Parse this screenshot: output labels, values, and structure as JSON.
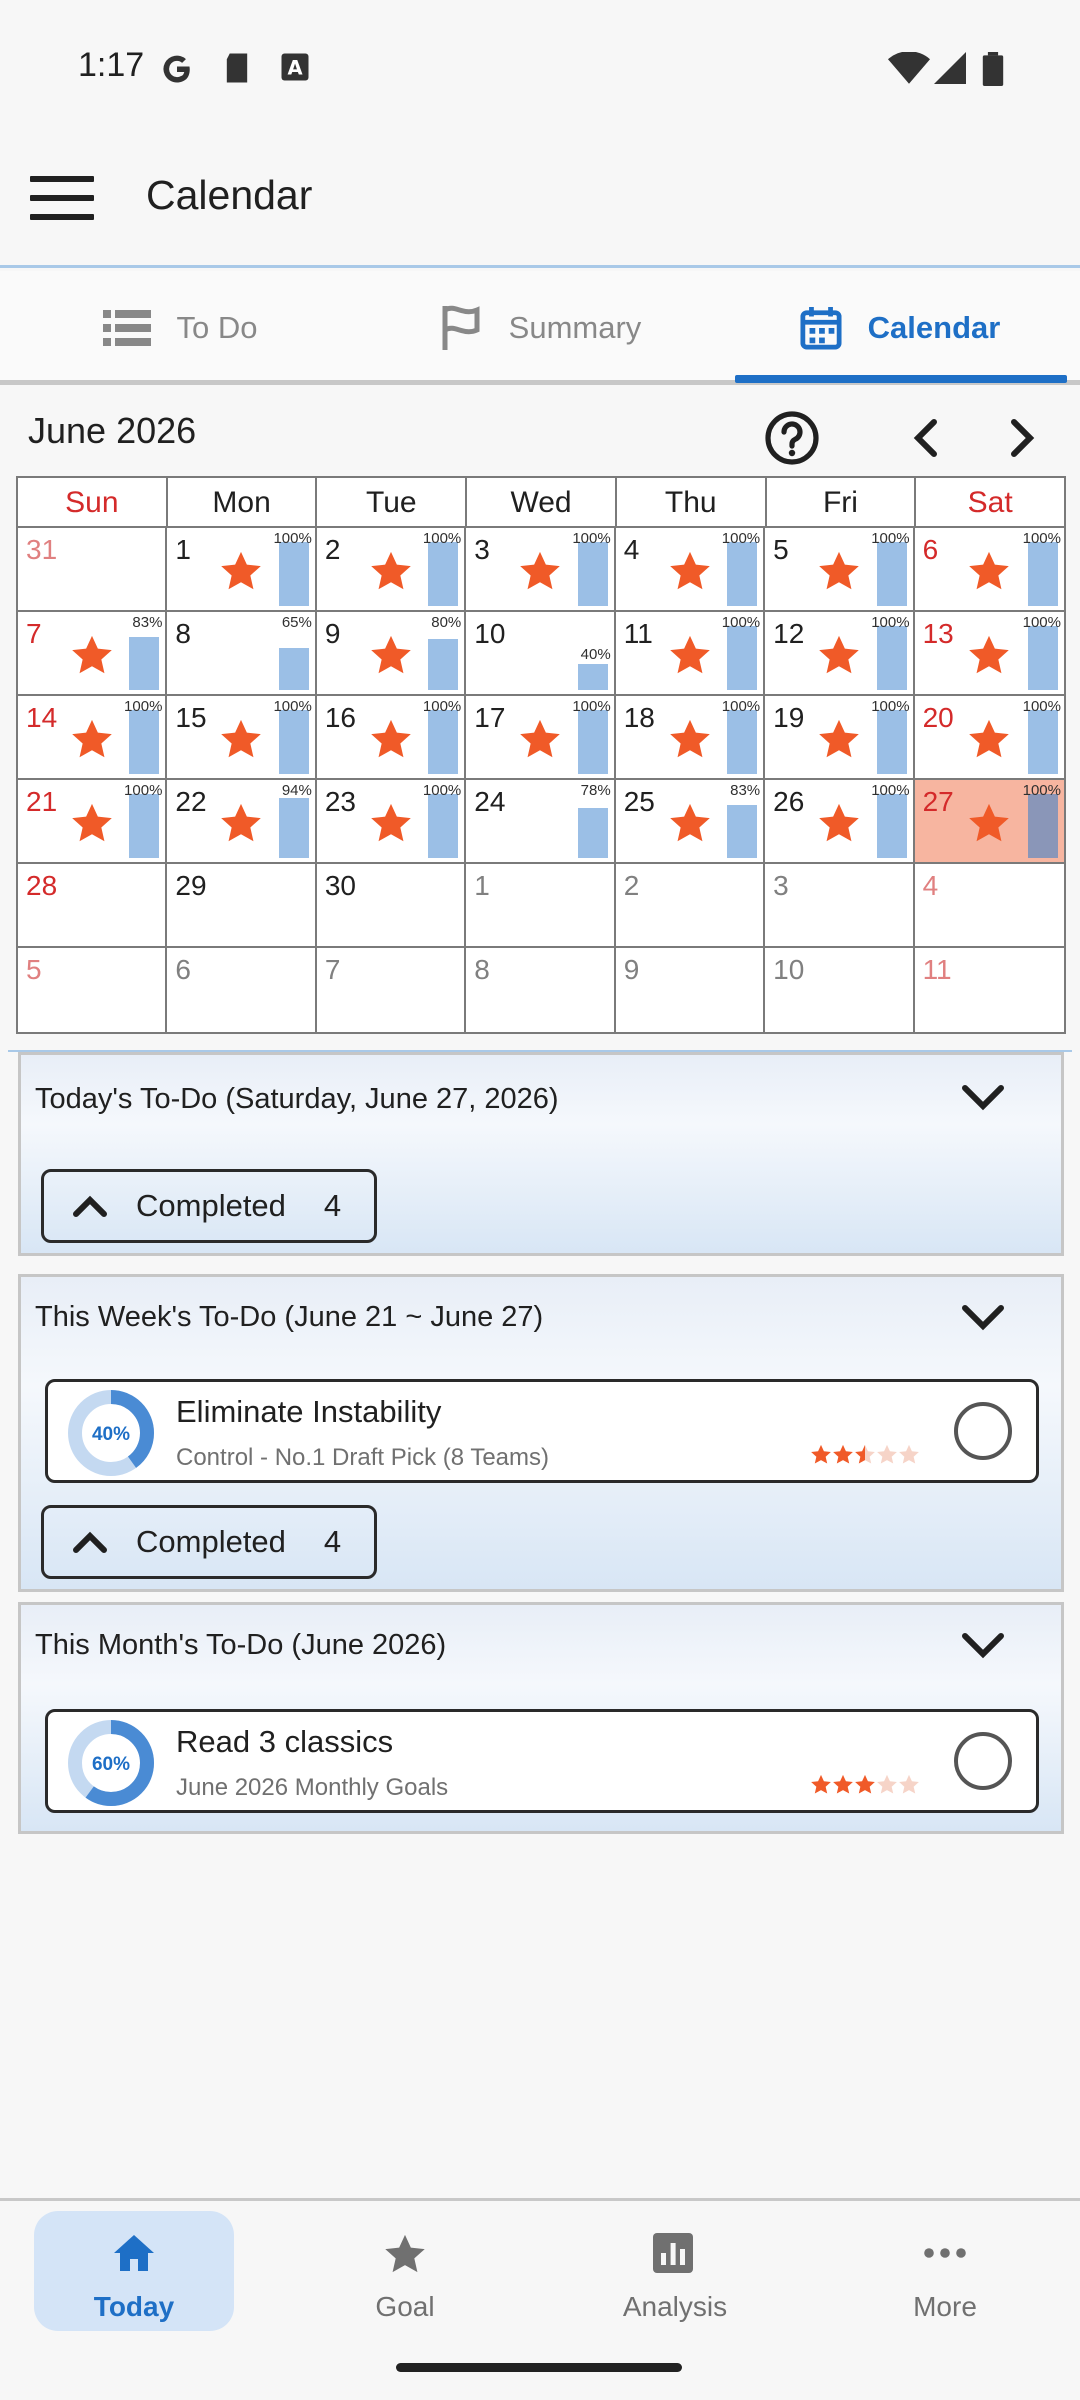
{
  "status_bar": {
    "time": "1:17"
  },
  "app_bar": {
    "title": "Calendar",
    "menu_icon": "hamburger-menu-icon"
  },
  "tabs": [
    {
      "label": "To Do",
      "icon": "list-icon",
      "active": false
    },
    {
      "label": "Summary",
      "icon": "flag-icon",
      "active": false
    },
    {
      "label": "Calendar",
      "icon": "calendar-icon",
      "active": true
    }
  ],
  "calendar": {
    "month_label": "June 2026",
    "weekdays": [
      "Sun",
      "Mon",
      "Tue",
      "Wed",
      "Thu",
      "Fri",
      "Sat"
    ],
    "weeks": [
      [
        {
          "d": "31",
          "o": true,
          "s": false,
          "p": null
        },
        {
          "d": "1",
          "s": true,
          "p": 100
        },
        {
          "d": "2",
          "s": true,
          "p": 100
        },
        {
          "d": "3",
          "s": true,
          "p": 100
        },
        {
          "d": "4",
          "s": true,
          "p": 100
        },
        {
          "d": "5",
          "s": true,
          "p": 100
        },
        {
          "d": "6",
          "s": true,
          "p": 100
        }
      ],
      [
        {
          "d": "7",
          "s": true,
          "p": 83
        },
        {
          "d": "8",
          "s": false,
          "p": 65
        },
        {
          "d": "9",
          "s": true,
          "p": 80
        },
        {
          "d": "10",
          "s": false,
          "p": 40
        },
        {
          "d": "11",
          "s": true,
          "p": 100
        },
        {
          "d": "12",
          "s": true,
          "p": 100
        },
        {
          "d": "13",
          "s": true,
          "p": 100
        }
      ],
      [
        {
          "d": "14",
          "s": true,
          "p": 100
        },
        {
          "d": "15",
          "s": true,
          "p": 100
        },
        {
          "d": "16",
          "s": true,
          "p": 100
        },
        {
          "d": "17",
          "s": true,
          "p": 100
        },
        {
          "d": "18",
          "s": true,
          "p": 100
        },
        {
          "d": "19",
          "s": true,
          "p": 100
        },
        {
          "d": "20",
          "s": true,
          "p": 100
        }
      ],
      [
        {
          "d": "21",
          "s": true,
          "p": 100
        },
        {
          "d": "22",
          "s": true,
          "p": 94
        },
        {
          "d": "23",
          "s": true,
          "p": 100
        },
        {
          "d": "24",
          "s": false,
          "p": 78
        },
        {
          "d": "25",
          "s": true,
          "p": 83
        },
        {
          "d": "26",
          "s": true,
          "p": 100
        },
        {
          "d": "27",
          "s": true,
          "p": 100,
          "today": true
        }
      ],
      [
        {
          "d": "28",
          "s": false,
          "p": null
        },
        {
          "d": "29",
          "s": false,
          "p": null
        },
        {
          "d": "30",
          "s": false,
          "p": null
        },
        {
          "d": "1",
          "o": true,
          "s": false,
          "p": null
        },
        {
          "d": "2",
          "o": true,
          "s": false,
          "p": null
        },
        {
          "d": "3",
          "o": true,
          "s": false,
          "p": null
        },
        {
          "d": "4",
          "o": true,
          "s": false,
          "p": null
        }
      ],
      [
        {
          "d": "5",
          "o": true,
          "s": false,
          "p": null
        },
        {
          "d": "6",
          "o": true,
          "s": false,
          "p": null
        },
        {
          "d": "7",
          "o": true,
          "s": false,
          "p": null
        },
        {
          "d": "8",
          "o": true,
          "s": false,
          "p": null
        },
        {
          "d": "9",
          "o": true,
          "s": false,
          "p": null
        },
        {
          "d": "10",
          "o": true,
          "s": false,
          "p": null
        },
        {
          "d": "11",
          "o": true,
          "s": false,
          "p": null
        }
      ]
    ]
  },
  "today_section": {
    "title": "Today's To-Do  (Saturday, June 27, 2026)",
    "completed_label": "Completed",
    "completed_count": "4"
  },
  "week_section": {
    "title": "This Week's To-Do  (June 21 ~ June 27)",
    "item": {
      "title": "Eliminate Instability",
      "subtitle": "Control - No.1 Draft Pick (8 Teams)",
      "progress": 40,
      "progress_label": "40%",
      "stars": 2.5
    },
    "completed_label": "Completed",
    "completed_count": "4"
  },
  "month_section": {
    "title": "This Month's To-Do  (June 2026)",
    "item": {
      "title": "Read 3 classics",
      "subtitle": "June 2026 Monthly Goals",
      "progress": 60,
      "progress_label": "60%",
      "stars": 3
    }
  },
  "bottom_nav": [
    {
      "label": "Today",
      "icon": "home-icon",
      "active": true
    },
    {
      "label": "Goal",
      "icon": "star-icon",
      "active": false
    },
    {
      "label": "Analysis",
      "icon": "bar-chart-icon",
      "active": false
    },
    {
      "label": "More",
      "icon": "more-dots-icon",
      "active": false
    }
  ],
  "colors": {
    "accent": "#1e6fc6",
    "star": "#f05a28",
    "bar": "#9bbfe6",
    "today_cell": "#f7b5a0",
    "weekend_red": "#d42a2a"
  }
}
